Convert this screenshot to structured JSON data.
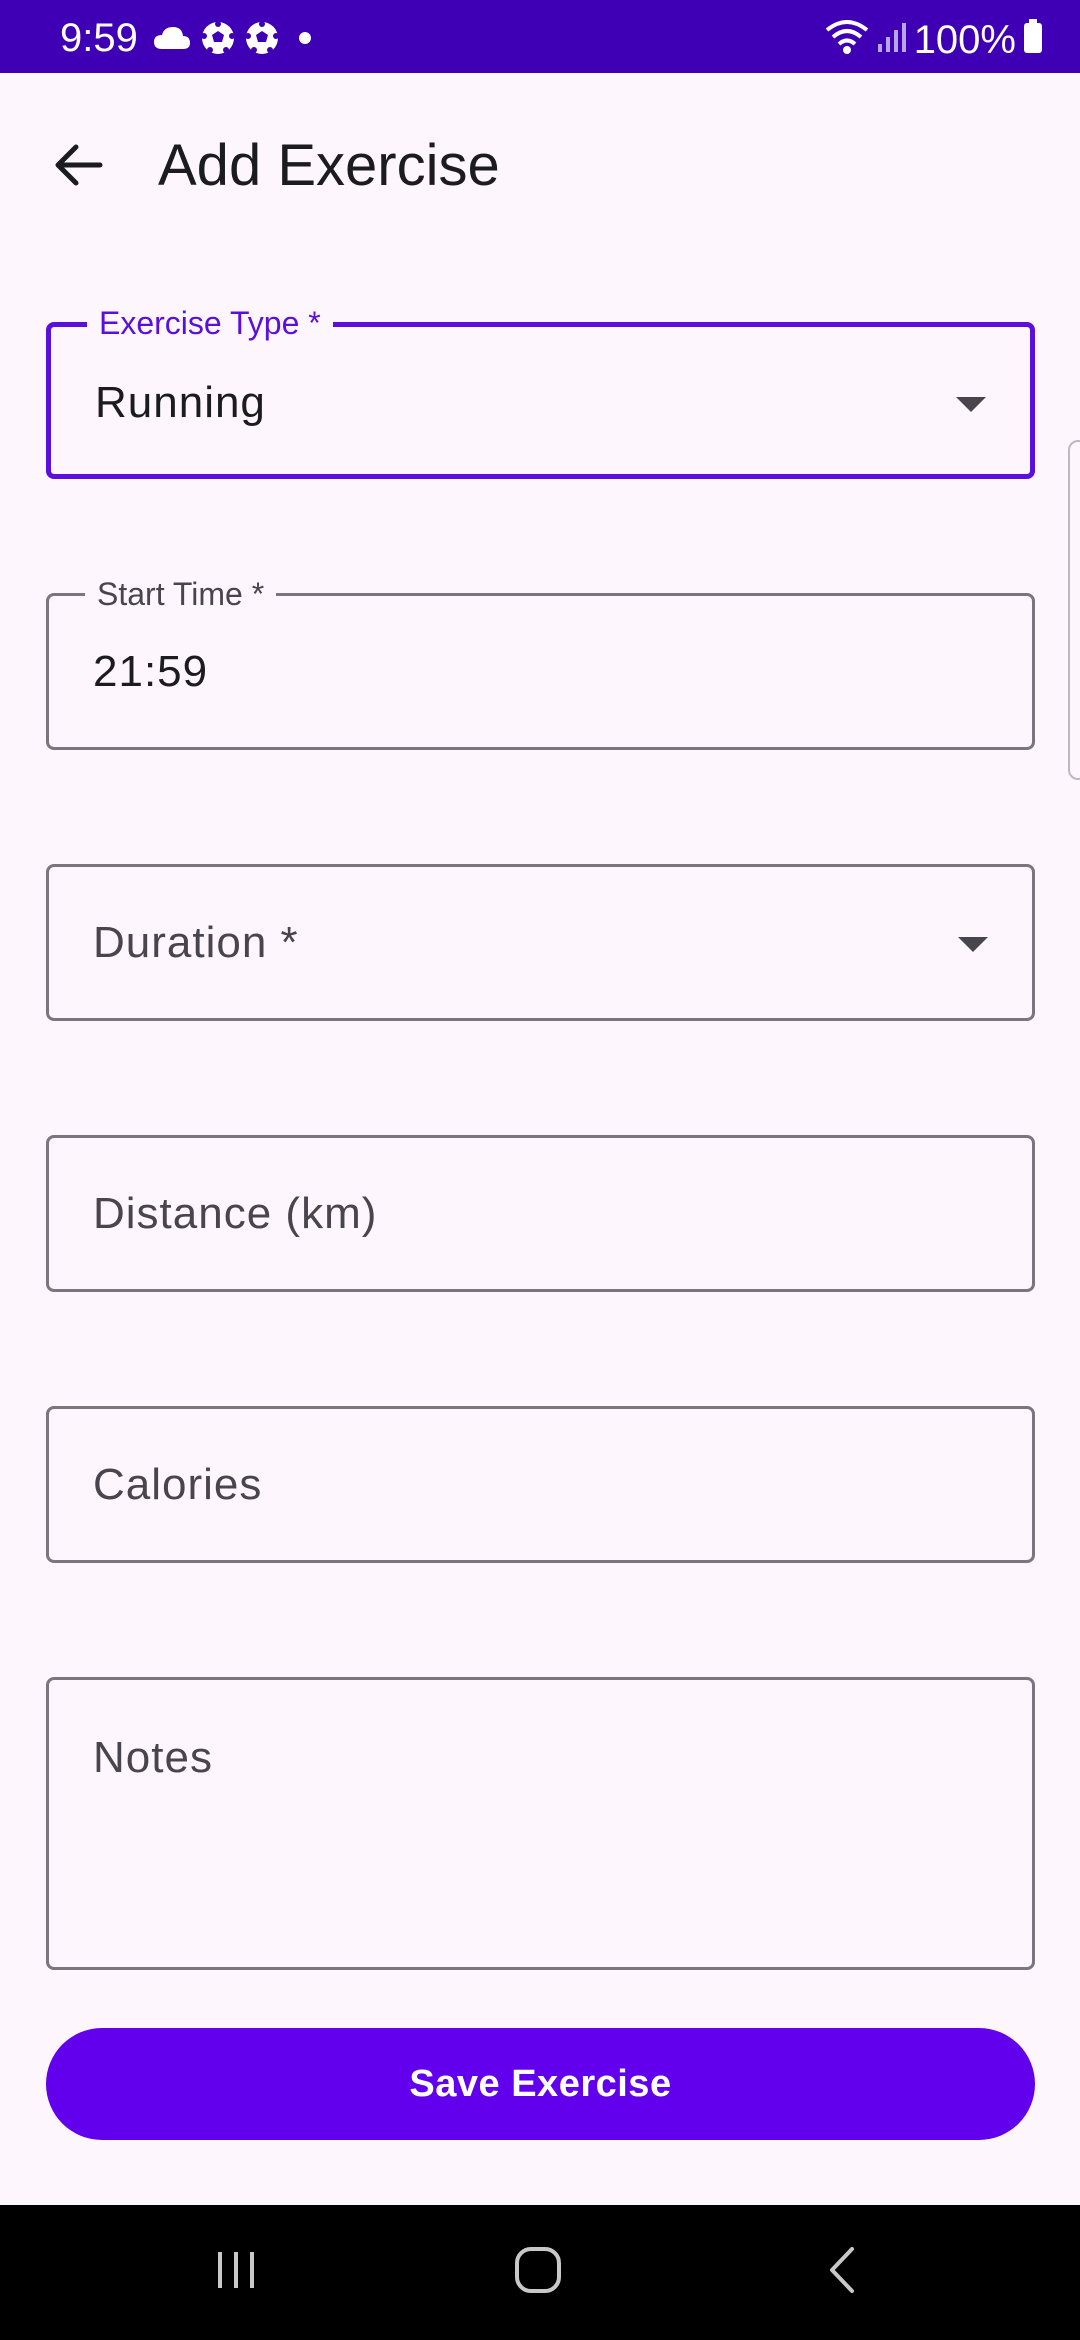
{
  "status_bar": {
    "time": "9:59",
    "notification_icons": [
      "cloud-icon",
      "soccer-ball-icon",
      "soccer-ball-icon",
      "dot-icon"
    ],
    "battery": "100%"
  },
  "app_bar": {
    "title": "Add Exercise",
    "back_icon": "arrow-left-icon"
  },
  "form": {
    "exercise_type": {
      "label": "Exercise Type *",
      "value": "Running"
    },
    "start_time": {
      "label": "Start Time *",
      "value": "21:59"
    },
    "duration": {
      "placeholder": "Duration *"
    },
    "distance": {
      "placeholder": "Distance (km)"
    },
    "calories": {
      "placeholder": "Calories"
    },
    "notes": {
      "placeholder": "Notes"
    }
  },
  "actions": {
    "save_label": "Save Exercise"
  },
  "colors": {
    "primary": "#6200ee",
    "status_bar": "#3f00b5",
    "focused_outline": "#5b0fdc",
    "background": "#fdf7fd"
  },
  "nav_bar": {
    "buttons": [
      "recent-apps-icon",
      "home-icon",
      "back-icon"
    ]
  }
}
